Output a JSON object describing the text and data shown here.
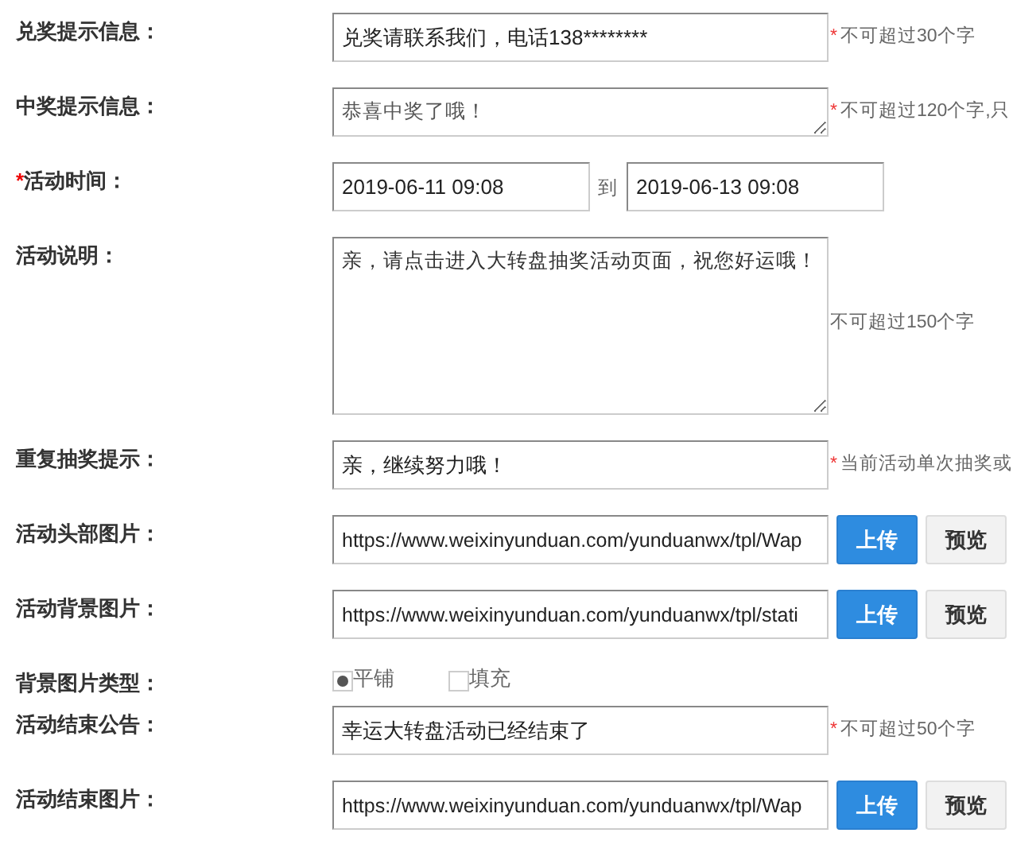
{
  "fields": [
    {
      "kind": "text",
      "label": "兑奖提示信息：",
      "value": "兑奖请联系我们，电话138********",
      "hint_mark": "*",
      "hint": "不可超过30个字"
    },
    {
      "kind": "textarea",
      "label": "中奖提示信息：",
      "value": "恭喜中奖了哦！",
      "hint_mark": "*",
      "hint": "不可超过120个字,只"
    },
    {
      "kind": "daterange",
      "label_mark": "*",
      "label": "活动时间：",
      "start": "2019-06-11 09:08",
      "separator": "到",
      "end": "2019-06-13 09:08"
    },
    {
      "kind": "memo",
      "label": "活动说明：",
      "value": "亲，请点击进入大转盘抽奖活动页面，祝您好运哦！",
      "hint": "不可超过150个字"
    },
    {
      "kind": "text",
      "label": "重复抽奖提示：",
      "value": "亲，继续努力哦！",
      "hint_mark": "*",
      "hint": "当前活动单次抽奖或"
    },
    {
      "kind": "upload",
      "label": "活动头部图片：",
      "value": "https://www.weixinyunduan.com/yunduanwx/tpl/Wap",
      "upload": "上传",
      "preview": "预览"
    },
    {
      "kind": "upload",
      "label": "活动背景图片：",
      "value": "https://www.weixinyunduan.com/yunduanwx/tpl/stati",
      "upload": "上传",
      "preview": "预览"
    },
    {
      "kind": "radio",
      "label": "背景图片类型：",
      "options": [
        {
          "label": "平铺",
          "selected": true
        },
        {
          "label": "填充",
          "selected": false
        }
      ]
    },
    {
      "kind": "text",
      "label": "活动结束公告：",
      "value": "幸运大转盘活动已经结束了",
      "hint_mark": "*",
      "hint": "不可超过50个字"
    },
    {
      "kind": "upload",
      "label": "活动结束图片：",
      "value": "https://www.weixinyunduan.com/yunduanwx/tpl/Wap",
      "upload": "上传",
      "preview": "预览"
    }
  ]
}
